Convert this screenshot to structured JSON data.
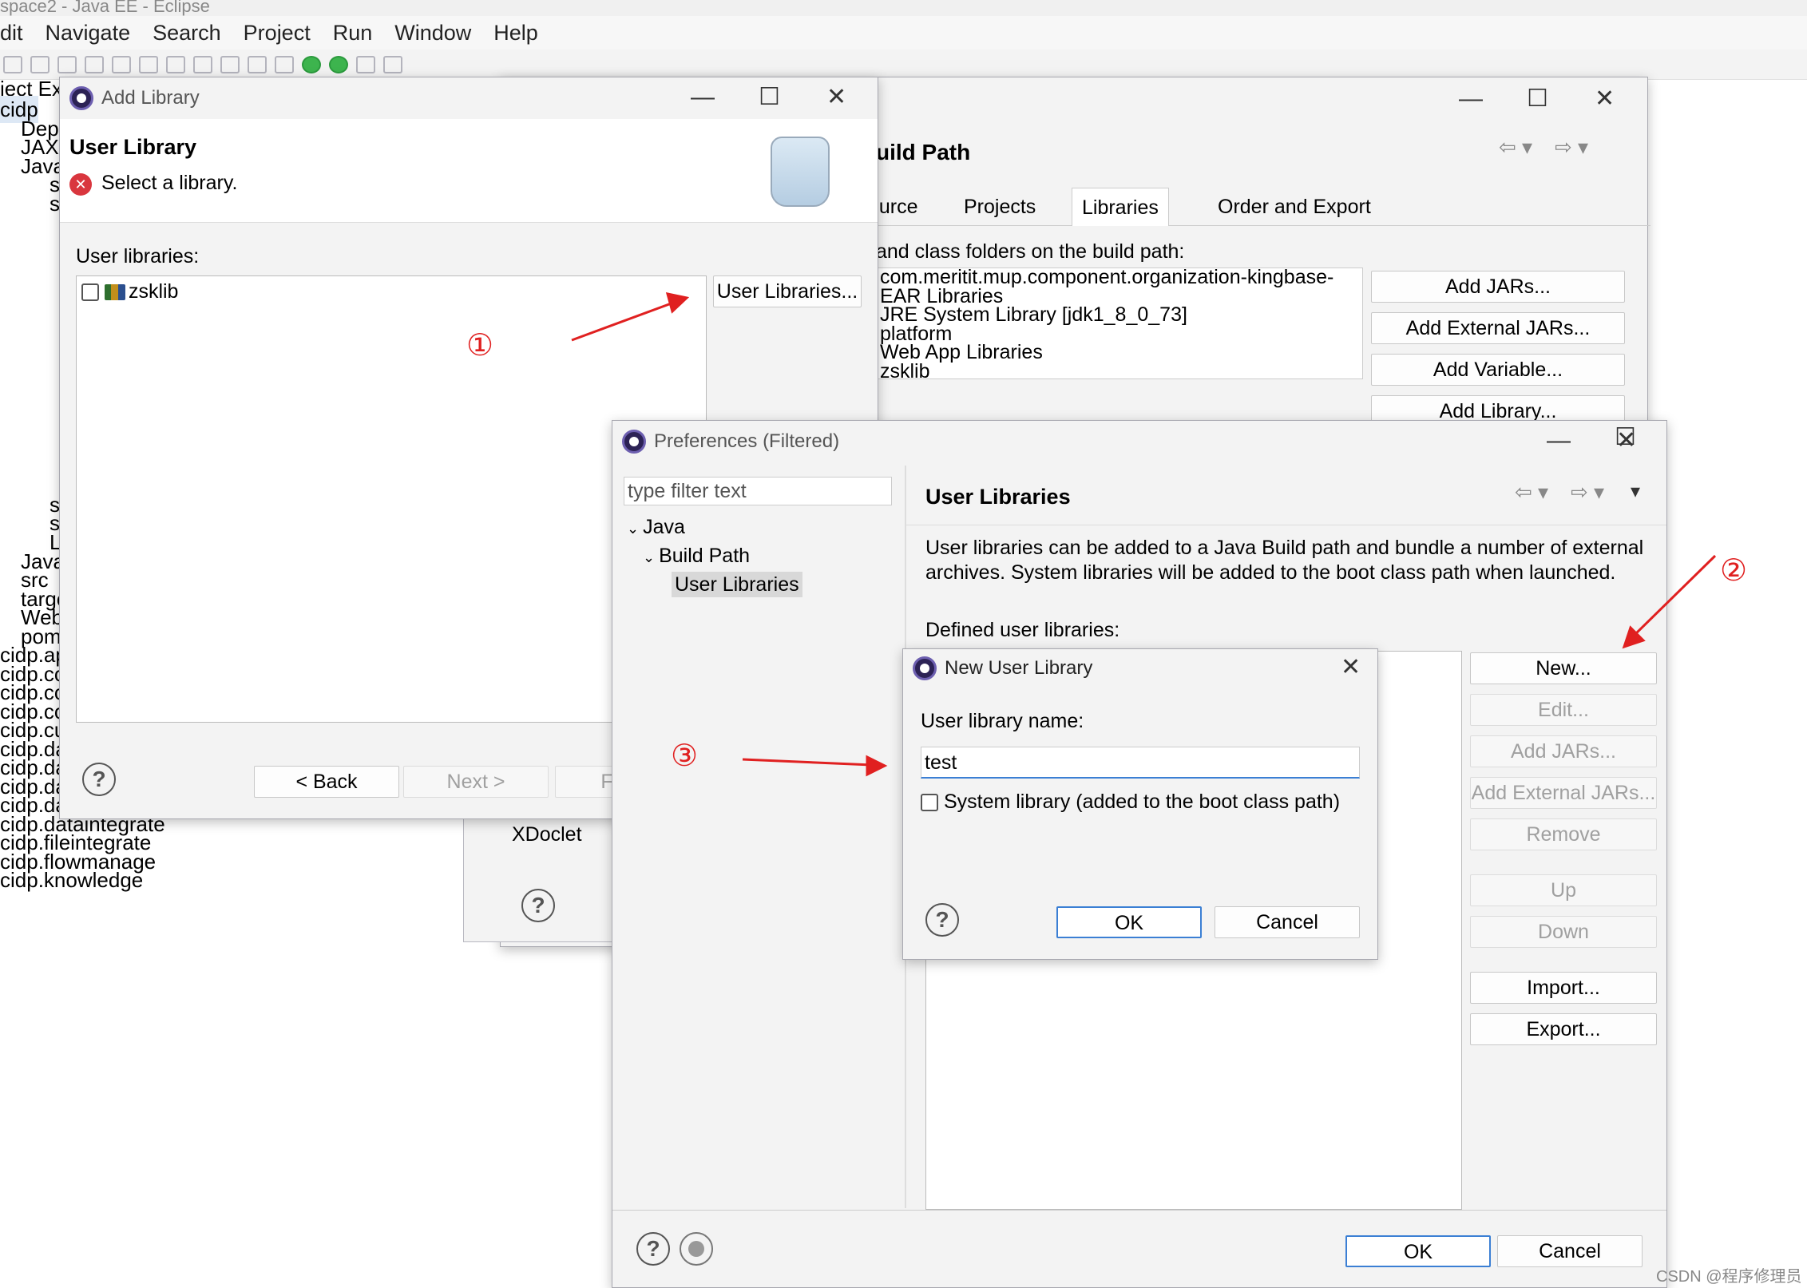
{
  "window_title": "space2 - Java EE - Eclipse",
  "menu": [
    "dit",
    "Navigate",
    "Search",
    "Project",
    "Run",
    "Window",
    "Help"
  ],
  "explorer": {
    "header": "ject Ex",
    "items": [
      "cidp",
      "Dep",
      "JAX-",
      "Java",
      "s",
      "s",
      "s",
      "s",
      "L",
      "Java",
      "src",
      "target",
      "WebContent",
      "pom.xml",
      "cidp.appconfig",
      "cidp.codemanage",
      "cidp.columnassign",
      "cidp.common",
      "cidp.customization",
      "cidp.dataanalysis",
      "cidp.dataapp",
      "cidp.dataclean",
      "cidp.datagather",
      "cidp.dataintegrate",
      "cidp.fileintegrate",
      "cidp.flowmanage",
      "cidp.knowledge"
    ]
  },
  "build_path": {
    "title": "uild Path",
    "tabs": [
      "ource",
      "Projects",
      "Libraries",
      "Order and Export"
    ],
    "desc": "and class folders on the build path:",
    "libraries": [
      "com.meritit.mup.component.organization-kingbase-",
      "EAR Libraries",
      "JRE System Library [jdk1_8_0_73]",
      "platform",
      "Web App Libraries",
      "zsklib"
    ],
    "buttons": [
      "Add JARs...",
      "Add External JARs...",
      "Add Variable...",
      "Add Library..."
    ],
    "xdoclet": "XDoclet"
  },
  "add_library": {
    "title": "Add Library",
    "heading": "User Library",
    "message": "Select a library.",
    "list_label": "User libraries:",
    "items": [
      "zsklib"
    ],
    "user_libraries_button": "User Libraries...",
    "back": "< Back",
    "next": "Next >",
    "finish": "F"
  },
  "preferences": {
    "title": "Preferences (Filtered)",
    "filter_placeholder": "type filter text",
    "tree": [
      "Java",
      "Build Path",
      "User Libraries"
    ],
    "page_title": "User Libraries",
    "description": "User libraries can be added to a Java Build path and bundle a number of external archives. System libraries will be added to the boot class path when launched.",
    "defined_label": "Defined user libraries:",
    "buttons": [
      "New...",
      "Edit...",
      "Add JARs...",
      "Add External JARs...",
      "Remove",
      "Up",
      "Down",
      "Import...",
      "Export..."
    ],
    "ok": "OK",
    "cancel": "Cancel"
  },
  "new_user_library": {
    "title": "New User Library",
    "name_label": "User library name:",
    "name_value": "test",
    "system_checkbox": "System library (added to the boot class path)",
    "ok": "OK",
    "cancel": "Cancel"
  },
  "annotations": [
    "①",
    "②",
    "③"
  ],
  "watermark": "CSDN @程序修理员",
  "colors": {
    "annotation_red": "#e02020",
    "default_button_border": "#3b7fd4"
  }
}
